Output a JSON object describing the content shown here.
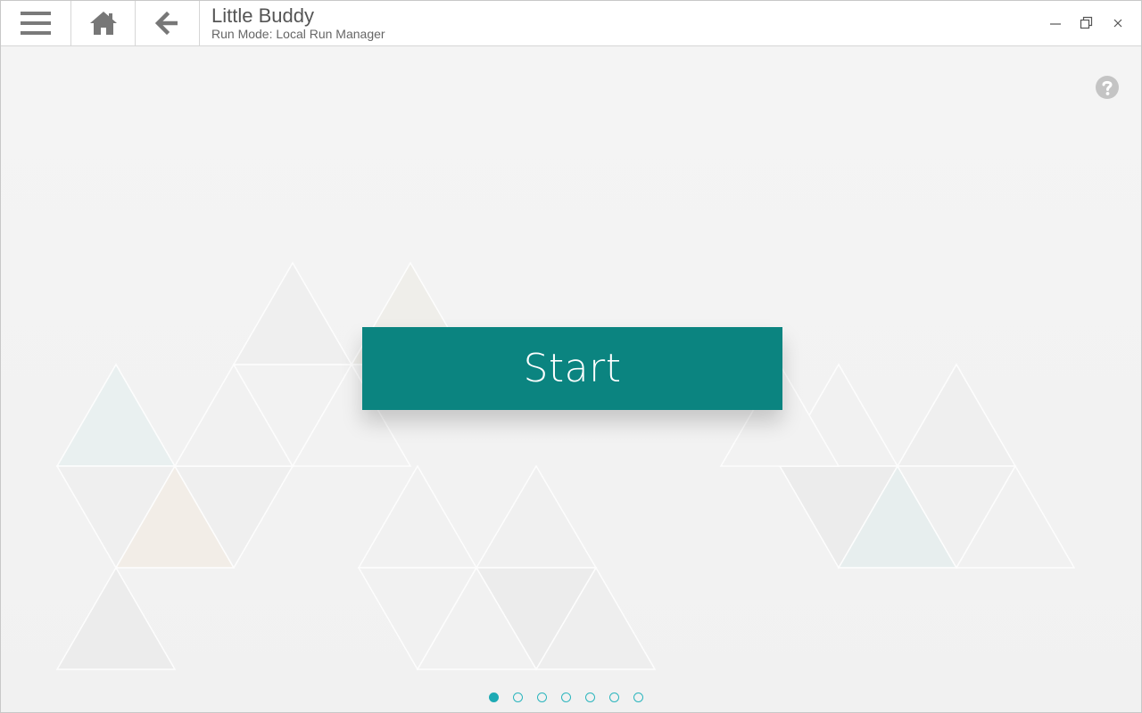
{
  "header": {
    "menu_icon": "hamburger-menu-icon",
    "home_icon": "home-icon",
    "back_icon": "back-arrow-icon",
    "title": "Little Buddy",
    "subtitle": "Run Mode: Local Run Manager"
  },
  "window_controls": {
    "minimize_icon": "minimize-icon",
    "restore_icon": "restore-icon",
    "close_icon": "close-icon"
  },
  "main": {
    "help_icon": "question-circle-icon",
    "start_label": "Start",
    "pager": {
      "count": 7,
      "active_index": 0
    }
  },
  "colors": {
    "accent": "#0b8480",
    "pager_active": "#1eaab4",
    "icon_gray": "#777777",
    "background": "#f3f3f3"
  }
}
